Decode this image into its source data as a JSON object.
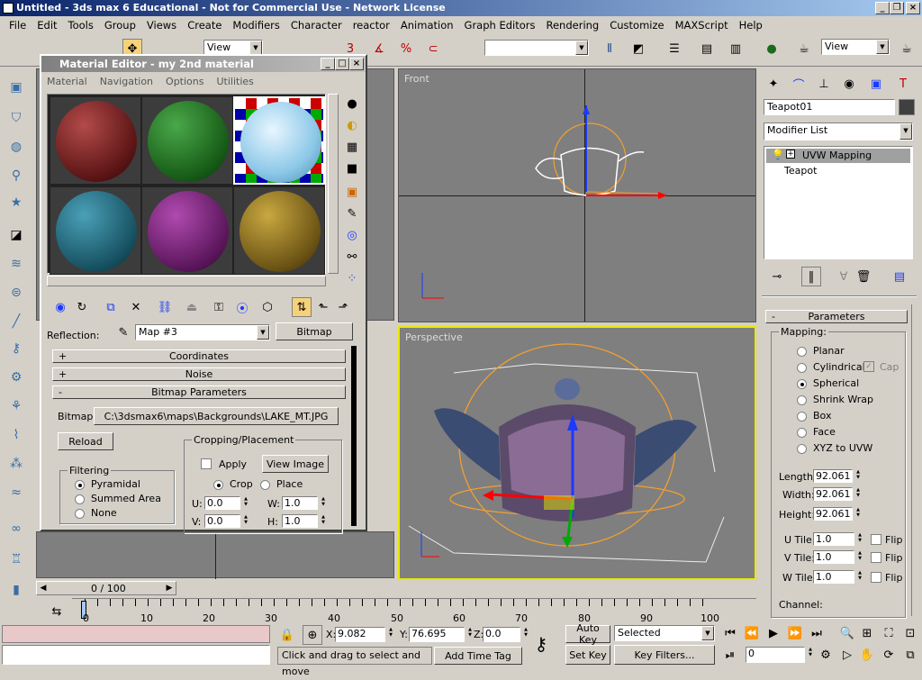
{
  "title": "Untitled - 3ds max 6 Educational - Not for Commercial Use - Network License",
  "menu": [
    "File",
    "Edit",
    "Tools",
    "Group",
    "Views",
    "Create",
    "Modifiers",
    "Character",
    "reactor",
    "Animation",
    "Graph Editors",
    "Rendering",
    "Customize",
    "MAXScript",
    "Help"
  ],
  "toolbar": {
    "view_combo": "View",
    "view_combo2": "View"
  },
  "medit": {
    "title": "Material Editor - my 2nd material",
    "menu": [
      "Material",
      "Navigation",
      "Options",
      "Utilities"
    ],
    "reflection_label": "Reflection:",
    "map_name": "Map #3",
    "map_type": "Bitmap",
    "rollouts": [
      {
        "sign": "+",
        "label": "Coordinates"
      },
      {
        "sign": "+",
        "label": "Noise"
      },
      {
        "sign": "-",
        "label": "Bitmap Parameters"
      }
    ],
    "bitmap_label": "Bitmap:",
    "bitmap_path": "C:\\3dsmax6\\maps\\Backgrounds\\LAKE_MT.JPG",
    "reload": "Reload",
    "cropping_title": "Cropping/Placement",
    "apply": "Apply",
    "view_image": "View Image",
    "crop": "Crop",
    "place": "Place",
    "u_label": "U:",
    "u_val": "0.0",
    "w_label": "W:",
    "w_val": "1.0",
    "v_label": "V:",
    "v_val": "0.0",
    "h_label": "H:",
    "h_val": "1.0",
    "filtering_title": "Filtering",
    "filters": [
      "Pyramidal",
      "Summed Area",
      "None"
    ]
  },
  "viewports": {
    "front": "Front",
    "perspective": "Perspective"
  },
  "cmd": {
    "object_name": "Teapot01",
    "modifier_list": "Modifier List",
    "stack": [
      "UVW Mapping",
      "Teapot"
    ],
    "params_title": "Parameters",
    "mapping_label": "Mapping:",
    "mapping": [
      "Planar",
      "Cylindrical",
      "Spherical",
      "Shrink Wrap",
      "Box",
      "Face",
      "XYZ to UVW"
    ],
    "cap": "Cap",
    "length_label": "Length:",
    "length": "92.061",
    "width_label": "Width:",
    "width": "92.061",
    "height_label": "Height:",
    "height": "92.061",
    "utile_label": "U Tile:",
    "utile": "1.0",
    "vtile_label": "V Tile:",
    "vtile": "1.0",
    "wtile_label": "W Tile:",
    "wtile": "1.0",
    "flip": "Flip",
    "channel": "Channel:"
  },
  "timeline": {
    "frame": "0 / 100",
    "ticks": [
      "0",
      "10",
      "20",
      "30",
      "40",
      "50",
      "60",
      "70",
      "80",
      "90",
      "100"
    ]
  },
  "status": {
    "x_label": "X:",
    "x": "9.082",
    "y_label": "Y:",
    "y": "76.695",
    "z_label": "Z:",
    "z": "0.0",
    "prompt": "Click and drag to select and move",
    "add_time_tag": "Add Time Tag",
    "auto_key": "Auto Key",
    "set_key": "Set Key",
    "selected": "Selected",
    "key_filters": "Key Filters...",
    "frame_field": "0"
  }
}
